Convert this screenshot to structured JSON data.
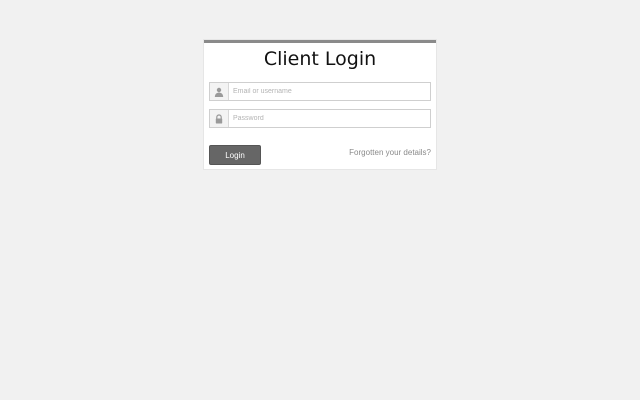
{
  "login": {
    "title": "Client Login",
    "username_placeholder": "Email or username",
    "password_placeholder": "Password",
    "username_icon": "user-icon",
    "password_icon": "lock-icon",
    "login_label": "Login",
    "forgot_label": "Forgotten your details?"
  },
  "colors": {
    "background": "#f1f1f1",
    "card": "#ffffff",
    "card_top_border": "#8a8a8a",
    "button": "#666666",
    "link": "#8a8a8a"
  }
}
